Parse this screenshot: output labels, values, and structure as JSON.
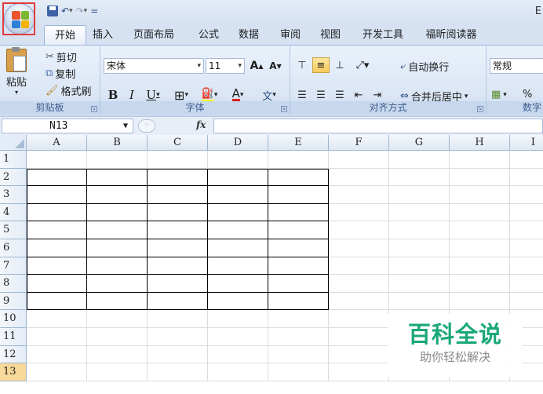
{
  "title_bar": {
    "title_fragment": "E"
  },
  "quick_access": {
    "separator": "="
  },
  "tabs": [
    {
      "label": "开始",
      "active": true
    },
    {
      "label": "插入"
    },
    {
      "label": "页面布局"
    },
    {
      "label": "公式"
    },
    {
      "label": "数据"
    },
    {
      "label": "审阅"
    },
    {
      "label": "视图"
    },
    {
      "label": "开发工具"
    },
    {
      "label": "福昕阅读器"
    }
  ],
  "clipboard": {
    "group_label": "剪贴板",
    "paste": "粘贴",
    "cut": "剪切",
    "copy": "复制",
    "format_painter": "格式刷"
  },
  "font": {
    "group_label": "字体",
    "font_name": "宋体",
    "font_size": "11",
    "grow": "A",
    "shrink": "A",
    "bold": "B",
    "italic": "I",
    "underline": "U",
    "font_color_letter": "A",
    "phonetic": "文"
  },
  "alignment": {
    "group_label": "对齐方式",
    "wrap_text": "自动换行",
    "merge_center": "合并后居中"
  },
  "number": {
    "group_label": "数字",
    "format": "常规",
    "percent": "%"
  },
  "formula_bar": {
    "name_box": "N13",
    "fx": "fx",
    "formula": ""
  },
  "sheet": {
    "columns": [
      "A",
      "B",
      "C",
      "D",
      "E",
      "F",
      "G",
      "H",
      "I"
    ],
    "rows": [
      "1",
      "2",
      "3",
      "4",
      "5",
      "6",
      "7",
      "8",
      "9",
      "10",
      "11",
      "12",
      "13"
    ],
    "selected_row": "13",
    "bordered_range": "A2:E9"
  },
  "watermark": {
    "title": "百科全说",
    "subtitle": "助你轻松解决"
  },
  "colors": {
    "ribbon_bg": "#dbe6f5",
    "accent_highlight": "#e03b3b",
    "watermark_green": "#1aa876"
  }
}
